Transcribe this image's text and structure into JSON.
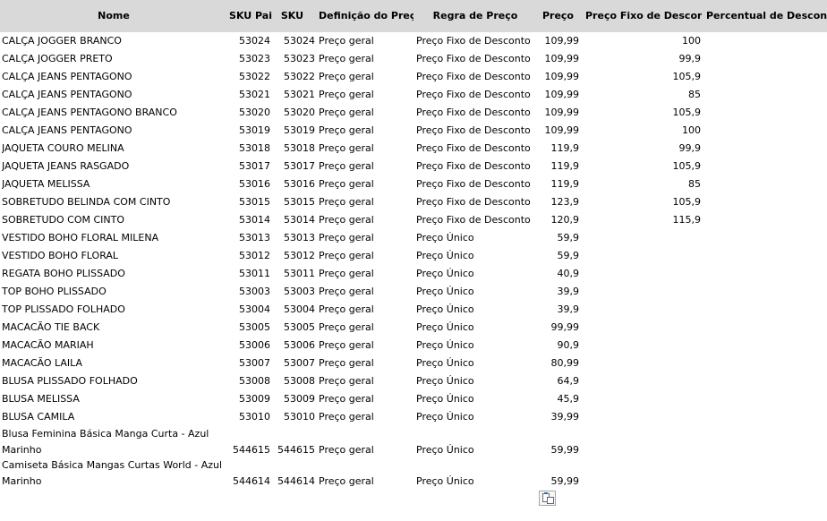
{
  "columns": {
    "nome": "Nome",
    "sku_pai": "SKU Pai",
    "sku": "SKU",
    "definicao": "Definição do Preço",
    "regra": "Regra de Preço",
    "preco": "Preço",
    "preco_fixo": "Preço Fixo de Desconto",
    "percentual": "Percentual de Desconto"
  },
  "rows": [
    {
      "nome": "CALÇA JOGGER BRANCO",
      "sku_pai": "53024",
      "sku": "53024",
      "definicao": "Preço geral",
      "regra": "Preço Fixo de Desconto",
      "preco": "109,99",
      "preco_fixo": "100",
      "percentual": ""
    },
    {
      "nome": "CALÇA JOGGER PRETO",
      "sku_pai": "53023",
      "sku": "53023",
      "definicao": "Preço geral",
      "regra": "Preço Fixo de Desconto",
      "preco": "109,99",
      "preco_fixo": "99,9",
      "percentual": ""
    },
    {
      "nome": "CALÇA JEANS PENTAGONO",
      "sku_pai": "53022",
      "sku": "53022",
      "definicao": "Preço geral",
      "regra": "Preço Fixo de Desconto",
      "preco": "109,99",
      "preco_fixo": "105,9",
      "percentual": ""
    },
    {
      "nome": "CALÇA JEANS PENTAGONO",
      "sku_pai": "53021",
      "sku": "53021",
      "definicao": "Preço geral",
      "regra": "Preço Fixo de Desconto",
      "preco": "109,99",
      "preco_fixo": "85",
      "percentual": ""
    },
    {
      "nome": "CALÇA JEANS PENTAGONO BRANCO",
      "sku_pai": "53020",
      "sku": "53020",
      "definicao": "Preço geral",
      "regra": "Preço Fixo de Desconto",
      "preco": "109,99",
      "preco_fixo": "105,9",
      "percentual": ""
    },
    {
      "nome": "CALÇA JEANS PENTAGONO",
      "sku_pai": "53019",
      "sku": "53019",
      "definicao": "Preço geral",
      "regra": "Preço Fixo de Desconto",
      "preco": "109,99",
      "preco_fixo": "100",
      "percentual": ""
    },
    {
      "nome": "JAQUETA COURO MELINA",
      "sku_pai": "53018",
      "sku": "53018",
      "definicao": "Preço geral",
      "regra": "Preço Fixo de Desconto",
      "preco": "119,9",
      "preco_fixo": "99,9",
      "percentual": ""
    },
    {
      "nome": "JAQUETA JEANS RASGADO",
      "sku_pai": "53017",
      "sku": "53017",
      "definicao": "Preço geral",
      "regra": "Preço Fixo de Desconto",
      "preco": "119,9",
      "preco_fixo": "105,9",
      "percentual": ""
    },
    {
      "nome": "JAQUETA MELISSA",
      "sku_pai": "53016",
      "sku": "53016",
      "definicao": "Preço geral",
      "regra": "Preço Fixo de Desconto",
      "preco": "119,9",
      "preco_fixo": "85",
      "percentual": ""
    },
    {
      "nome": "SOBRETUDO BELINDA COM CINTO",
      "sku_pai": "53015",
      "sku": "53015",
      "definicao": "Preço geral",
      "regra": "Preço Fixo de Desconto",
      "preco": "123,9",
      "preco_fixo": "105,9",
      "percentual": ""
    },
    {
      "nome": "SOBRETUDO COM CINTO",
      "sku_pai": "53014",
      "sku": "53014",
      "definicao": "Preço geral",
      "regra": "Preço Fixo de Desconto",
      "preco": "120,9",
      "preco_fixo": "115,9",
      "percentual": ""
    },
    {
      "nome": "VESTIDO BOHO FLORAL MILENA",
      "sku_pai": "53013",
      "sku": "53013",
      "definicao": "Preço geral",
      "regra": "Preço Único",
      "preco": "59,9",
      "preco_fixo": "",
      "percentual": ""
    },
    {
      "nome": "VESTIDO BOHO FLORAL",
      "sku_pai": "53012",
      "sku": "53012",
      "definicao": "Preço geral",
      "regra": "Preço Único",
      "preco": "59,9",
      "preco_fixo": "",
      "percentual": ""
    },
    {
      "nome": "REGATA BOHO PLISSADO",
      "sku_pai": "53011",
      "sku": "53011",
      "definicao": "Preço geral",
      "regra": "Preço Único",
      "preco": "40,9",
      "preco_fixo": "",
      "percentual": ""
    },
    {
      "nome": "TOP BOHO PLISSADO",
      "sku_pai": "53003",
      "sku": "53003",
      "definicao": "Preço geral",
      "regra": "Preço Único",
      "preco": "39,9",
      "preco_fixo": "",
      "percentual": ""
    },
    {
      "nome": "TOP PLISSADO FOLHADO",
      "sku_pai": "53004",
      "sku": "53004",
      "definicao": "Preço geral",
      "regra": "Preço Único",
      "preco": "39,9",
      "preco_fixo": "",
      "percentual": ""
    },
    {
      "nome": "MACACÃO TIE BACK",
      "sku_pai": "53005",
      "sku": "53005",
      "definicao": "Preço geral",
      "regra": "Preço Único",
      "preco": "99,99",
      "preco_fixo": "",
      "percentual": ""
    },
    {
      "nome": "MACACÃO MARIAH",
      "sku_pai": "53006",
      "sku": "53006",
      "definicao": "Preço geral",
      "regra": "Preço Único",
      "preco": "90,9",
      "preco_fixo": "",
      "percentual": ""
    },
    {
      "nome": "MACACÃO LAILA",
      "sku_pai": "53007",
      "sku": "53007",
      "definicao": "Preço geral",
      "regra": "Preço Único",
      "preco": "80,99",
      "preco_fixo": "",
      "percentual": ""
    },
    {
      "nome": "BLUSA PLISSADO FOLHADO",
      "sku_pai": "53008",
      "sku": "53008",
      "definicao": "Preço geral",
      "regra": "Preço Único",
      "preco": "64,9",
      "preco_fixo": "",
      "percentual": ""
    },
    {
      "nome": "BLUSA MELISSA",
      "sku_pai": "53009",
      "sku": "53009",
      "definicao": "Preço geral",
      "regra": "Preço Único",
      "preco": "45,9",
      "preco_fixo": "",
      "percentual": ""
    },
    {
      "nome": "BLUSA CAMILA",
      "sku_pai": "53010",
      "sku": "53010",
      "definicao": "Preço geral",
      "regra": "Preço Único",
      "preco": "39,99",
      "preco_fixo": "",
      "percentual": ""
    },
    {
      "nome": "Blusa Feminina Básica Manga Curta - Azul Marinho",
      "sku_pai": "544615",
      "sku": "544615",
      "definicao": "Preço geral",
      "regra": "Preço Único",
      "preco": "59,99",
      "preco_fixo": "",
      "percentual": "",
      "tall": true
    },
    {
      "nome": "Camiseta Básica Mangas Curtas World - Azul Marinho",
      "sku_pai": "544614",
      "sku": "544614",
      "definicao": "Preço geral",
      "regra": "Preço Único",
      "preco": "59,99",
      "preco_fixo": "",
      "percentual": "",
      "tall": true
    }
  ],
  "paste_options": {
    "icon": "paste-options-icon"
  }
}
